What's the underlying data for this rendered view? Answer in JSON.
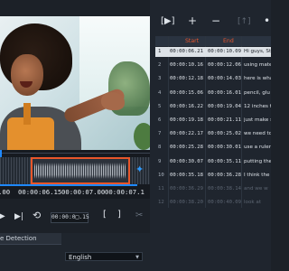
{
  "timeline": {
    "timecodes": [
      ".00",
      "00:00:06.15",
      "00:00:07.00",
      "00:00:07.1"
    ]
  },
  "transport": {
    "time_value": "00:00:0□.15"
  },
  "bottom_panel": {
    "tab_label": "e Detection",
    "language_value": "English"
  },
  "subtitle_table": {
    "headers": {
      "start": "Start",
      "end": "End"
    },
    "rows": [
      {
        "num": "1",
        "start": "00:00:06.21",
        "end": "00:00:10.09",
        "text": "Hi guys, Ste",
        "selected": true
      },
      {
        "num": "2",
        "start": "00:00:10.16",
        "end": "00:00:12.06",
        "text": "using mate"
      },
      {
        "num": "3",
        "start": "00:00:12.18",
        "end": "00:00:14.03",
        "text": "here is wha"
      },
      {
        "num": "4",
        "start": "00:00:15.06",
        "end": "00:00:16.01",
        "text": "pencil, glu"
      },
      {
        "num": "5",
        "start": "00:00:16.22",
        "end": "00:00:19.04",
        "text": "12 inches t"
      },
      {
        "num": "6",
        "start": "00:00:19.18",
        "end": "00:00:21.11",
        "text": "just make s"
      },
      {
        "num": "7",
        "start": "00:00:22.17",
        "end": "00:00:25.02",
        "text": "we need to"
      },
      {
        "num": "8",
        "start": "00:00:25.28",
        "end": "00:00:30.01",
        "text": "use a ruler"
      },
      {
        "num": "9",
        "start": "00:00:30.07",
        "end": "00:00:35.11",
        "text": "putting the"
      },
      {
        "num": "10",
        "start": "00:00:35.18",
        "end": "00:00:36.28",
        "text": "I think the"
      },
      {
        "num": "11",
        "start": "00:00:36.29",
        "end": "00:00:38.14",
        "text": "and we w",
        "faded": true
      },
      {
        "num": "12",
        "start": "00:00:38.20",
        "end": "00:00:40.09",
        "text": "look at",
        "faded": true
      }
    ]
  }
}
